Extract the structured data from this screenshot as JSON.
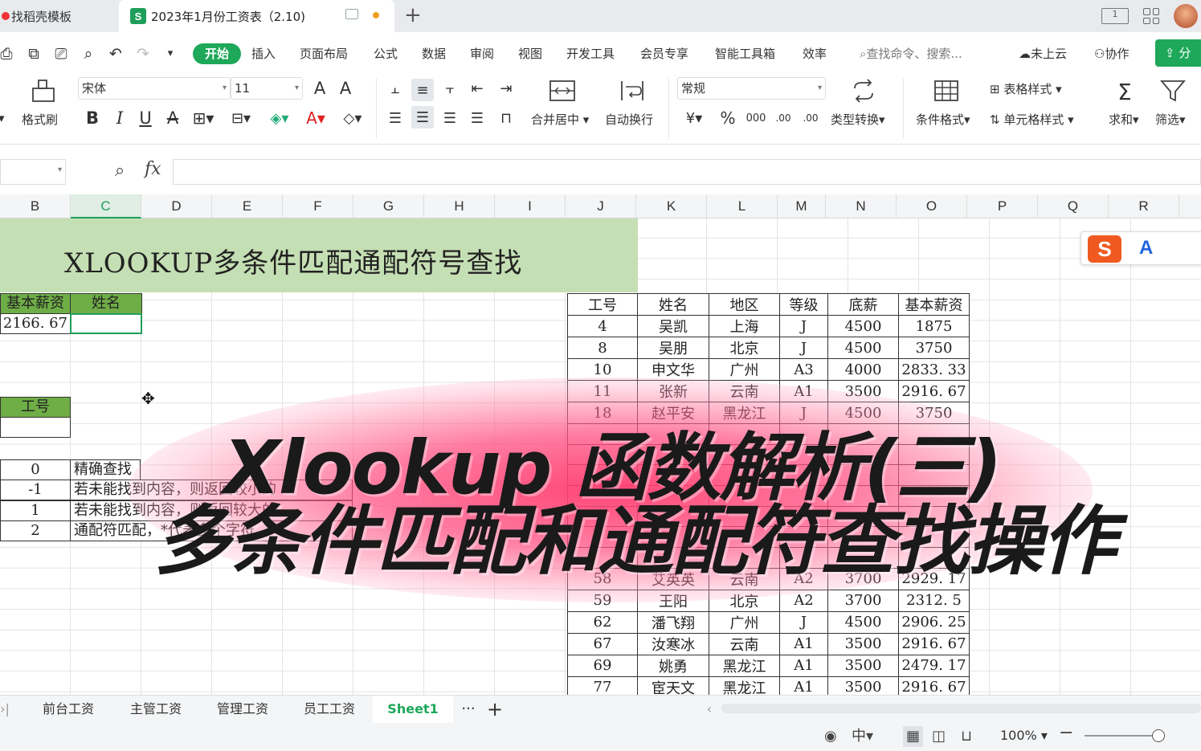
{
  "tabs": {
    "first": "找稻壳模板",
    "active": "2023年1月份工资表（2.10)",
    "active_icon": "S"
  },
  "topright": {
    "view_box": "1",
    "avatar": "user-avatar"
  },
  "menu": {
    "start": "开始",
    "items": [
      "插入",
      "页面布局",
      "公式",
      "数据",
      "审阅",
      "视图",
      "开发工具",
      "会员专享",
      "智能工具箱",
      "效率"
    ],
    "search": "查找命令、搜索...",
    "cloud": "未上云",
    "collab": "协作",
    "share": "分"
  },
  "ribbon": {
    "format_painter": "格式刷",
    "font_name": "宋体",
    "font_size": "11",
    "merge": "合并居中",
    "wrap": "自动换行",
    "number_format": "常规",
    "convert": "类型转换",
    "cond_format": "条件格式",
    "table_style": "表格样式",
    "cell_style": "单元格样式",
    "sum": "求和",
    "filter": "筛选",
    "bold": "B",
    "italic": "I",
    "underline": "U",
    "strike": "A",
    "font_color": "A",
    "grow_font": "A",
    "shrink_font": "A",
    "currency": "¥",
    "percent": "%",
    "thousands": "000",
    "dec_inc": ".00",
    "dec_dec": ".00"
  },
  "formula_bar": {
    "fx": "fx",
    "value": ""
  },
  "columns": [
    "B",
    "C",
    "D",
    "E",
    "F",
    "G",
    "H",
    "I",
    "J",
    "K",
    "L",
    "M",
    "N",
    "O",
    "P",
    "Q",
    "R"
  ],
  "active_column": "C",
  "sheet": {
    "title": "XLOOKUP多条件匹配通配符号查找",
    "left_headers": [
      "基本薪资",
      "姓名"
    ],
    "left_values": [
      "2166. 67",
      ""
    ],
    "id_header": "工号",
    "lookup_modes": [
      {
        "code": "0",
        "desc": "精确查找"
      },
      {
        "code": "-1",
        "desc": "若未能找到内容，则返回较小的"
      },
      {
        "code": "1",
        "desc": "若未能找到内容，则返回较大的"
      },
      {
        "code": "2",
        "desc": "通配符匹配，*代表多个字符"
      }
    ],
    "table_headers": [
      "工号",
      "姓名",
      "地区",
      "等级",
      "底薪",
      "基本薪资"
    ],
    "table_rows": [
      [
        "4",
        "吴凯",
        "上海",
        "J",
        "4500",
        "1875"
      ],
      [
        "8",
        "吴朋",
        "北京",
        "J",
        "4500",
        "3750"
      ],
      [
        "10",
        "申文华",
        "广州",
        "A3",
        "4000",
        "2833. 33"
      ],
      [
        "11",
        "张新",
        "云南",
        "A1",
        "3500",
        "2916. 67"
      ],
      [
        "18",
        "赵平安",
        "黑龙江",
        "J",
        "4500",
        "3750"
      ],
      [
        "",
        "",
        "",
        "",
        "",
        ""
      ],
      [
        "",
        "",
        "",
        "",
        "",
        ""
      ],
      [
        "",
        "",
        "",
        "",
        "",
        ""
      ],
      [
        "",
        "",
        "",
        "",
        "",
        ""
      ],
      [
        "",
        "",
        "",
        "",
        "",
        ""
      ],
      [
        "",
        "",
        "",
        "",
        "",
        ""
      ],
      [
        "",
        "",
        "",
        "",
        "",
        ""
      ],
      [
        "58",
        "艾英英",
        "云南",
        "A2",
        "3700",
        "2929. 17"
      ],
      [
        "59",
        "王阳",
        "北京",
        "A2",
        "3700",
        "2312. 5"
      ],
      [
        "62",
        "潘飞翔",
        "广州",
        "J",
        "4500",
        "2906. 25"
      ],
      [
        "67",
        "汝寒冰",
        "云南",
        "A1",
        "3500",
        "2916. 67"
      ],
      [
        "69",
        "姚勇",
        "黑龙江",
        "A1",
        "3500",
        "2479. 17"
      ],
      [
        "77",
        "宦天文",
        "黑龙江",
        "A1",
        "3500",
        "2916. 67"
      ]
    ]
  },
  "overlay": {
    "line1": "Xlookup 函数解析(三)",
    "line2": "多条件匹配和通配符查找操作"
  },
  "ime": {
    "logo": "S",
    "mode": "A"
  },
  "sheet_tabs": [
    "前台工资",
    "主管工资",
    "管理工资",
    "员工工资",
    "Sheet1"
  ],
  "active_sheet": "Sheet1",
  "status": {
    "zoom": "100%",
    "zoom_level": 1.0
  },
  "colors": {
    "accent": "#1ea85a",
    "title_band": "#c5dfb4",
    "header_green": "#6fae47",
    "overlay_glow": "#ff3c6e"
  }
}
